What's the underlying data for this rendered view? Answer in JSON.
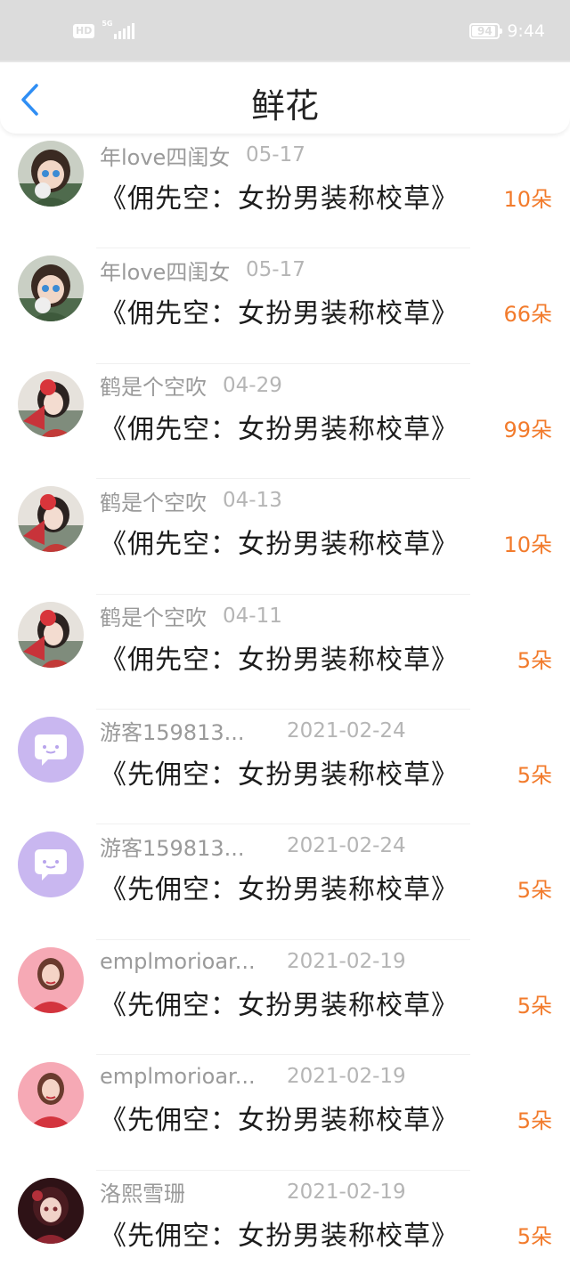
{
  "status_bar": {
    "hd_badge": "HD",
    "network": "5G",
    "battery": "94",
    "battery_level": 0.94,
    "time": "9:44"
  },
  "header": {
    "title": "鲜花",
    "back_icon": "chevron-left-icon"
  },
  "colors": {
    "accent_blue": "#2f8ef4",
    "count_orange": "#f27b2c",
    "username_gray": "#9a9a9a",
    "date_gray": "#b5b5b5",
    "status_bar_bg": "#dcdcdc"
  },
  "records": [
    {
      "user": "年love四闺女",
      "date": "05-17",
      "book": "《佣先空：女扮男装称校草》",
      "count": "10朵",
      "avatar": "girl-green-avatar"
    },
    {
      "user": "年love四闺女",
      "date": "05-17",
      "book": "《佣先空：女扮男装称校草》",
      "count": "66朵",
      "avatar": "girl-green-avatar"
    },
    {
      "user": "鹤是个空吹",
      "date": "04-29",
      "book": "《佣先空：女扮男装称校草》",
      "count": "99朵",
      "avatar": "girl-fan-avatar"
    },
    {
      "user": "鹤是个空吹",
      "date": "04-13",
      "book": "《佣先空：女扮男装称校草》",
      "count": "10朵",
      "avatar": "girl-fan-avatar"
    },
    {
      "user": "鹤是个空吹",
      "date": "04-11",
      "book": "《佣先空：女扮男装称校草》",
      "count": "5朵",
      "avatar": "girl-fan-avatar"
    },
    {
      "user": "游客159813...",
      "date": "2021-02-24",
      "book": "《先佣空：女扮男装称校草》",
      "count": "5朵",
      "avatar": "guest-avatar"
    },
    {
      "user": "游客159813...",
      "date": "2021-02-24",
      "book": "《先佣空：女扮男装称校草》",
      "count": "5朵",
      "avatar": "guest-avatar"
    },
    {
      "user": "emplmorioar...",
      "date": "2021-02-19",
      "book": "《先佣空：女扮男装称校草》",
      "count": "5朵",
      "avatar": "girl-red-sweater-avatar"
    },
    {
      "user": "emplmorioar...",
      "date": "2021-02-19",
      "book": "《先佣空：女扮男装称校草》",
      "count": "5朵",
      "avatar": "girl-red-sweater-avatar"
    },
    {
      "user": "洛熙雪珊",
      "date": "2021-02-19",
      "book": "《先佣空：女扮男装称校草》",
      "count": "5朵",
      "avatar": "girl-dark-red-avatar"
    }
  ]
}
